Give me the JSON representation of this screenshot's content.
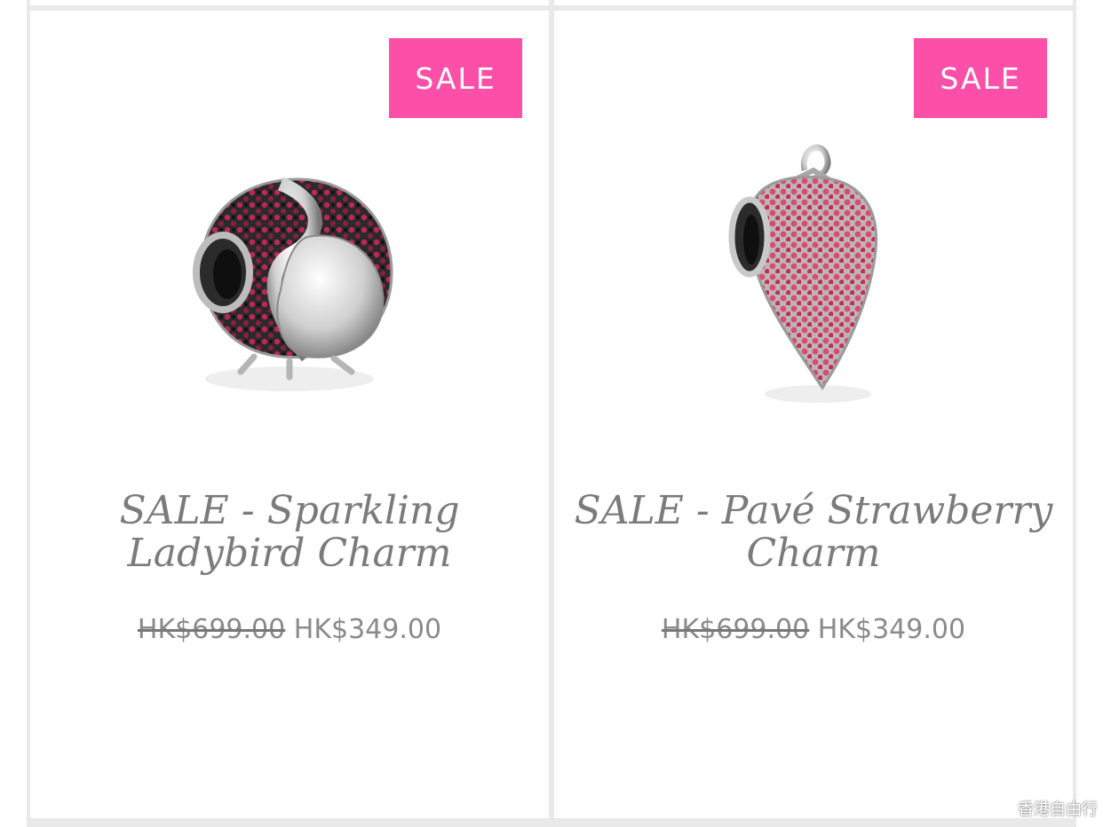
{
  "products": [
    {
      "badge": "SALE",
      "title": "SALE - Sparkling Ladybird Charm",
      "price_original": "HK$699.00",
      "price_sale": "HK$349.00",
      "image_icon": "ladybird-charm-image"
    },
    {
      "badge": "SALE",
      "title": "SALE - Pavé Strawberry Charm",
      "price_original": "HK$699.00",
      "price_sale": "HK$349.00",
      "image_icon": "strawberry-charm-image"
    }
  ],
  "watermark": {
    "text": "香港自由行",
    "icon": "wechat-icon"
  },
  "colors": {
    "sale_badge": "#fc4fa8",
    "title_text": "#7b7b7b",
    "price_text": "#8a8a8a",
    "grid_line": "#e9e9e9"
  }
}
